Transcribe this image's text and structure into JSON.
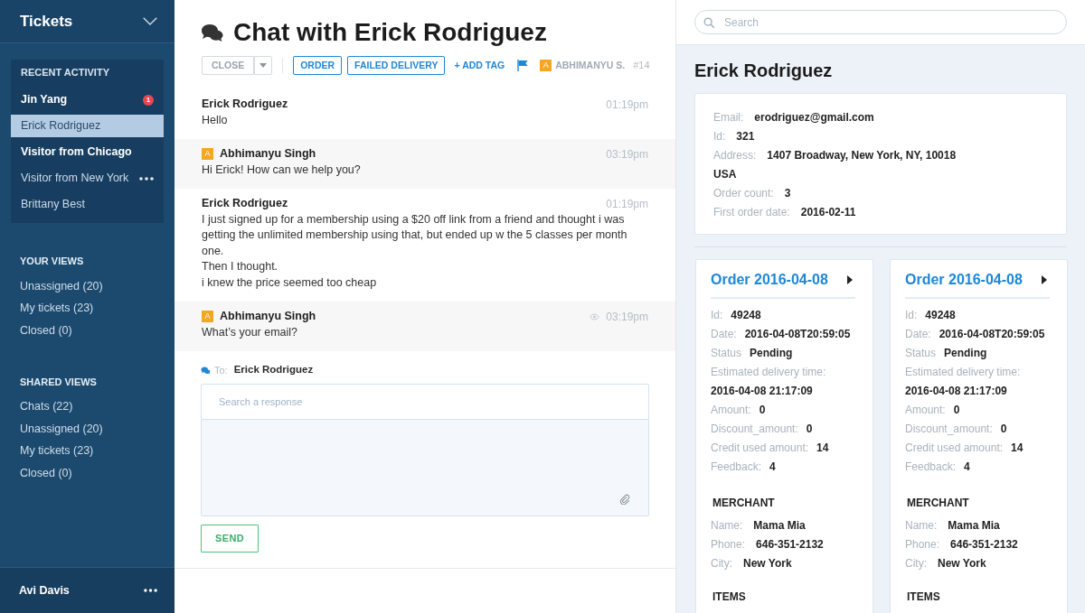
{
  "sidebar": {
    "title": "Tickets",
    "recent": {
      "heading": "RECENT ACTIVITY",
      "items": [
        {
          "label": "Jin Yang",
          "unread": true,
          "selected": false,
          "typing": false,
          "badge": "1"
        },
        {
          "label": "Erick Rodriguez",
          "unread": false,
          "selected": true,
          "typing": false
        },
        {
          "label": "Visitor from Chicago",
          "unread": true,
          "selected": false,
          "typing": false
        },
        {
          "label": "Visitor from New York",
          "unread": false,
          "selected": false,
          "typing": true
        },
        {
          "label": "Brittany Best",
          "unread": false,
          "selected": false,
          "typing": false
        }
      ]
    },
    "views": [
      {
        "heading": "YOUR VIEWS",
        "items": [
          "Unassigned (20)",
          "My tickets (23)",
          "Closed (0)"
        ]
      },
      {
        "heading": "SHARED VIEWS",
        "items": [
          "Chats (22)",
          "Unassigned (20)",
          "My tickets (23)",
          "Closed (0)"
        ]
      }
    ],
    "user": {
      "name": "Avi Davis"
    }
  },
  "chat": {
    "title": "Chat with Erick Rodriguez",
    "toolbar": {
      "close_button": "CLOSE",
      "tags": [
        "ORDER",
        "FAILED DELIVERY"
      ],
      "add_tag": "+ ADD TAG",
      "assignee": {
        "avatar": "A",
        "name": "ABHIMANYU S."
      },
      "ticket_number": "#14"
    },
    "messages": [
      {
        "kind": "customer",
        "author": "Erick Rodriguez",
        "time": "01:19pm",
        "seen": false,
        "lines": [
          "Hello"
        ]
      },
      {
        "kind": "agent",
        "avatar": "A",
        "author": "Abhimanyu Singh",
        "time": "03:19pm",
        "seen": false,
        "lines": [
          "Hi Erick! How can we help you?"
        ]
      },
      {
        "kind": "customer",
        "author": "Erick Rodriguez",
        "time": "01:19pm",
        "seen": false,
        "lines": [
          "I just signed up for a membership using a $20 off link from a friend and thought i was getting the unlimited membership using that, but ended up w the 5 classes per month one.",
          "Then I thought.",
          "i knew the price seemed too cheap"
        ]
      },
      {
        "kind": "agent",
        "avatar": "A",
        "author": "Abhimanyu Singh",
        "time": "03:19pm",
        "seen": true,
        "lines": [
          "What’s your email?"
        ]
      }
    ],
    "reply": {
      "to_label": "To:",
      "recipient": "Erick Rodriguez",
      "search": {
        "placeholder": "Search a response"
      },
      "send_button": "SEND"
    }
  },
  "customer": {
    "search": {
      "placeholder": "Search"
    },
    "name": "Erick Rodriguez",
    "fields": [
      {
        "label": "Email:",
        "value": "erodriguez@gmail.com"
      },
      {
        "label": "Id:",
        "value": "321"
      },
      {
        "label": "Address:",
        "value": "1407 Broadway, New York, NY, 10018"
      },
      {
        "value": "USA"
      },
      {
        "label": "Order count:",
        "value": "3"
      },
      {
        "label": "First order date:",
        "value": "2016-02-11"
      }
    ],
    "orders": [
      {
        "title": "Order 2016-04-08",
        "fields": [
          {
            "label": "Id:",
            "value": "49248"
          },
          {
            "label": "Date:",
            "value": "2016-04-08T20:59:05"
          },
          {
            "label": "Status",
            "value": "Pending"
          },
          {
            "label": "Estimated delivery time:"
          },
          {
            "value": "2016-04-08 21:17:09"
          },
          {
            "label": "Amount:",
            "value": "0"
          },
          {
            "label": "Discount_amount:",
            "value": "0"
          },
          {
            "label": "Credit used amount:",
            "value": "14"
          },
          {
            "label": "Feedback:",
            "value": "4"
          }
        ],
        "merchant": {
          "heading": "MERCHANT",
          "fields": [
            {
              "label": "Name:",
              "value": "Mama Mia"
            },
            {
              "label": "Phone:",
              "value": "646-351-2132"
            },
            {
              "label": "City:",
              "value": "New York"
            }
          ]
        },
        "items_heading": "ITEMS"
      },
      {
        "title": "Order 2016-04-08",
        "fields": [
          {
            "label": "Id:",
            "value": "49248"
          },
          {
            "label": "Date:",
            "value": "2016-04-08T20:59:05"
          },
          {
            "label": "Status",
            "value": "Pending"
          },
          {
            "label": "Estimated delivery time:"
          },
          {
            "value": "2016-04-08 21:17:09"
          },
          {
            "label": "Amount:",
            "value": "0"
          },
          {
            "label": "Discount_amount:",
            "value": "0"
          },
          {
            "label": "Credit used amount:",
            "value": "14"
          },
          {
            "label": "Feedback:",
            "value": "4"
          }
        ],
        "merchant": {
          "heading": "MERCHANT",
          "fields": [
            {
              "label": "Name:",
              "value": "Mama Mia"
            },
            {
              "label": "Phone:",
              "value": "646-351-2132"
            },
            {
              "label": "City:",
              "value": "New York"
            }
          ]
        },
        "items_heading": "ITEMS"
      }
    ]
  }
}
